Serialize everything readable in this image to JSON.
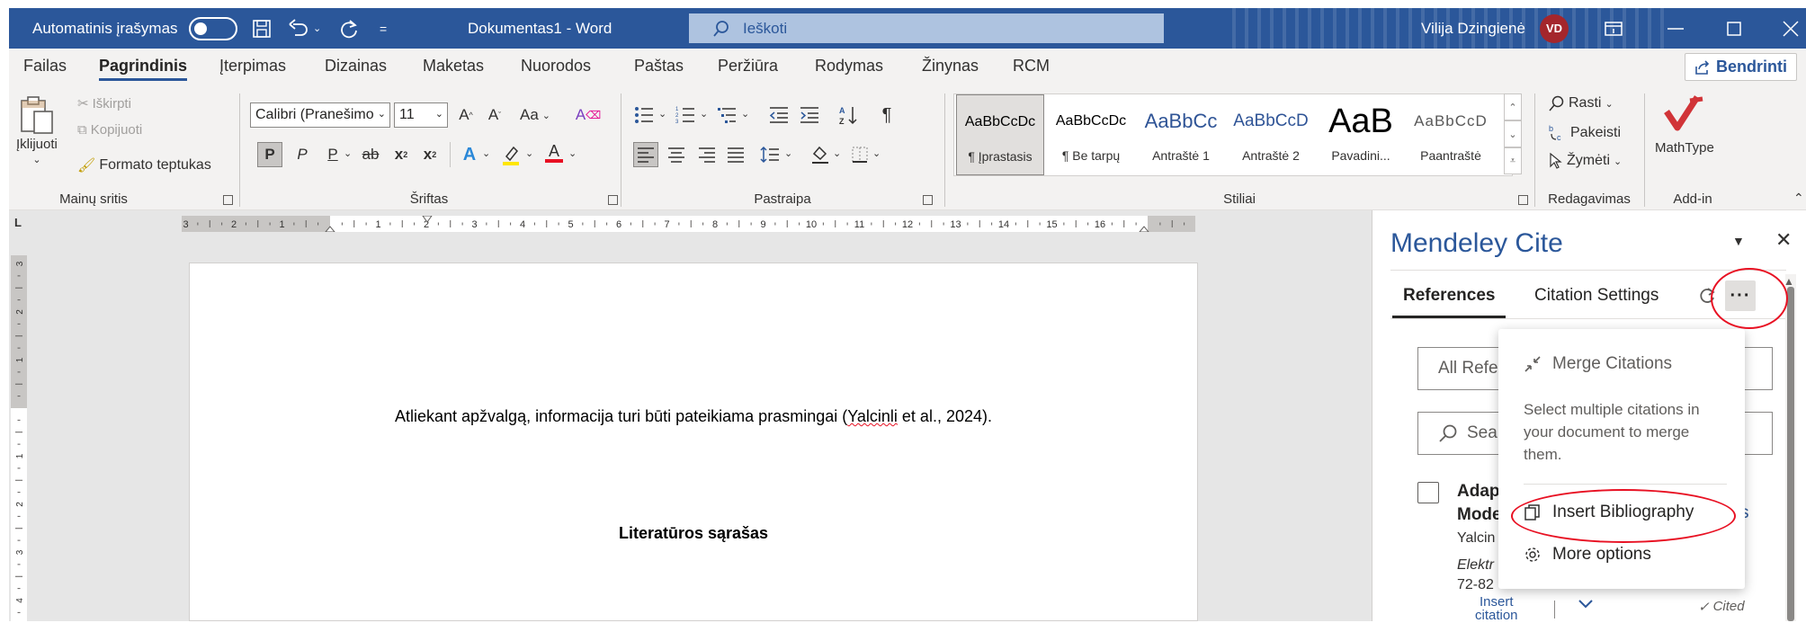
{
  "titlebar": {
    "autosave_label": "Automatinis įrašymas",
    "doc_title": "Dokumentas1  -  Word",
    "search_placeholder": "Ieškoti",
    "user_name": "Vilija Dzingienė",
    "user_initials": "VD",
    "accent": "#2b579a"
  },
  "tabs": [
    "Failas",
    "Pagrindinis",
    "Įterpimas",
    "Dizainas",
    "Maketas",
    "Nuorodos",
    "Paštas",
    "Peržiūra",
    "Rodymas",
    "Žinynas",
    "RCM"
  ],
  "active_tab": "Pagrindinis",
  "share_label": "Bendrinti",
  "ribbon": {
    "clipboard": {
      "paste": "Įklijuoti",
      "cut": "Iškirpti",
      "copy": "Kopijuoti",
      "format_painter": "Formato teptukas",
      "label": "Mainų sritis"
    },
    "font": {
      "name": "Calibri (Pranešimo",
      "size": "11",
      "label": "Šriftas",
      "change_case": "Aa",
      "bold": "P",
      "italic": "P",
      "underline": "P",
      "strike": "ab",
      "subscript": "x",
      "superscript": "x"
    },
    "paragraph": {
      "label": "Pastraipa"
    },
    "styles": {
      "label": "Stiliai",
      "items": [
        {
          "preview": "AaBbCcDc",
          "name": "¶ Įprastasis"
        },
        {
          "preview": "AaBbCcDc",
          "name": "¶ Be tarpų"
        },
        {
          "preview": "AaBbCc",
          "name": "Antraštė 1"
        },
        {
          "preview": "AaBbCcD",
          "name": "Antraštė 2"
        },
        {
          "preview": "AaB",
          "name": "Pavadini..."
        },
        {
          "preview": "AaBbCcD",
          "name": "Paantraštė"
        }
      ]
    },
    "editing": {
      "find": "Rasti",
      "replace": "Pakeisti",
      "select": "Žymėti",
      "label": "Redagavimas"
    },
    "addin": {
      "mathtype": "MathType",
      "label": "Add-in"
    }
  },
  "ruler": {
    "ticks": [
      "3",
      "2",
      "1",
      "1",
      "2",
      "3",
      "4",
      "5",
      "6",
      "7",
      "8",
      "9",
      "10",
      "11",
      "12",
      "13",
      "14",
      "15",
      "16"
    ],
    "vticks": [
      "3",
      "2",
      "1",
      "1",
      "2",
      "3",
      "4"
    ]
  },
  "document": {
    "paragraph_before": "Atliekant apžvalgą, informacija turi būti pateikiama prasmingai (",
    "paragraph_name": "Yalcinli",
    "paragraph_after": " et al., 2024).",
    "heading": "Literatūros sąrašas"
  },
  "pane": {
    "title": "Mendeley Cite",
    "tabs": [
      "References",
      "Citation Settings"
    ],
    "filter_label": "All Refe",
    "search_placeholder": "Sear",
    "ref_title_1": "Adap",
    "ref_title_2": "Mode",
    "ref_title_3": "s",
    "ref_author": "Yalcin",
    "ref_source_1": "Elektr",
    "ref_source_2": "72-82",
    "insert_citation_1": "Insert",
    "insert_citation_2": "citation",
    "cited_label": "Cited",
    "menu": {
      "merge": "Merge Citations",
      "merge_desc": "Select multiple citations in your document to merge them.",
      "insert_bibliography": "Insert Bibliography",
      "more_options": "More options"
    },
    "highlight_color": "#e81123"
  }
}
